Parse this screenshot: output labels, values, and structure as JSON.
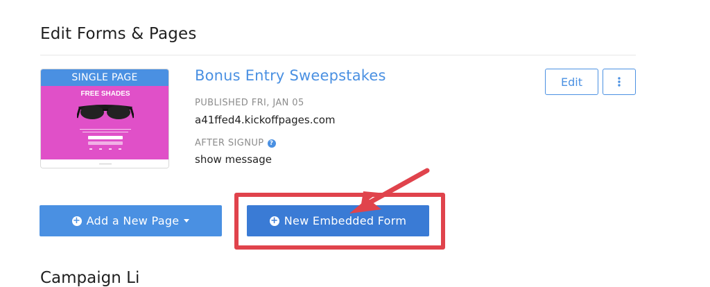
{
  "section": {
    "title": "Edit Forms & Pages"
  },
  "page": {
    "thumbnail": {
      "header": "SINGLE PAGE",
      "headline": "FREE SHADES"
    },
    "title": "Bonus Entry Sweepstakes",
    "published_label": "PUBLISHED FRI, JAN 05",
    "url": "a41ffed4.kickoffpages.com",
    "after_signup_label": "AFTER SIGNUP",
    "after_signup_value": "show message"
  },
  "actions": {
    "edit_label": "Edit",
    "more_icon": "vertical-ellipsis-icon"
  },
  "buttons": {
    "add_page_label": "Add a New Page",
    "embedded_form_label": "New Embedded Form"
  },
  "colors": {
    "accent": "#4a90e2",
    "button_primary": "#3a7bd5",
    "thumbnail_bg": "#e050c8",
    "highlight": "#e0434c"
  },
  "next_section": {
    "title": "Campaign Li"
  }
}
